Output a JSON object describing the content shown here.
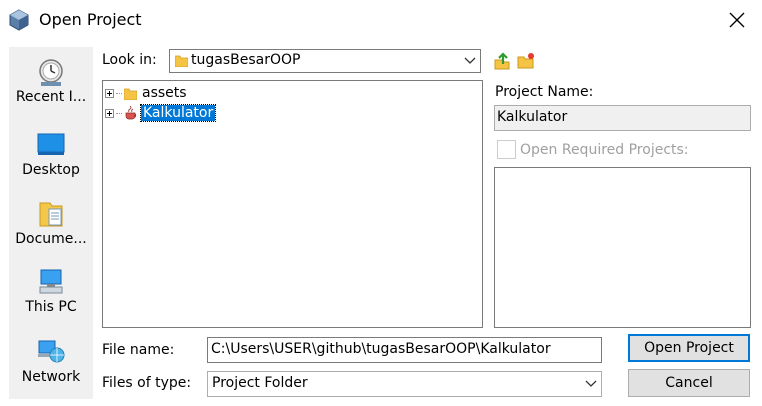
{
  "window": {
    "title": "Open Project",
    "close_icon": "close-icon"
  },
  "places": [
    {
      "label": "Recent I...",
      "icon": "recent-items-icon"
    },
    {
      "label": "Desktop",
      "icon": "desktop-icon"
    },
    {
      "label": "Docume...",
      "icon": "documents-icon"
    },
    {
      "label": "This PC",
      "icon": "this-pc-icon"
    },
    {
      "label": "Network",
      "icon": "network-icon"
    }
  ],
  "look_in": {
    "label": "Look in:",
    "value": "tugasBesarOOP"
  },
  "toolbar": {
    "up_icon": "up-one-level-icon",
    "new_folder_icon": "new-folder-icon"
  },
  "tree": {
    "items": [
      {
        "label": "assets",
        "icon": "folder-icon",
        "selected": false
      },
      {
        "label": "Kalkulator",
        "icon": "java-project-icon",
        "selected": true
      }
    ]
  },
  "project_panel": {
    "name_label": "Project Name:",
    "name_value": "Kalkulator",
    "required_label": "Open Required Projects:"
  },
  "file_name": {
    "label": "File name:",
    "value": "C:\\Users\\USER\\github\\tugasBesarOOP\\Kalkulator"
  },
  "file_type": {
    "label": "Files of type:",
    "value": "Project Folder"
  },
  "buttons": {
    "open": "Open Project",
    "cancel": "Cancel"
  },
  "colors": {
    "selection": "#0078d7",
    "default_button_border": "#0078d7",
    "places_bg": "#f0f0f0"
  }
}
